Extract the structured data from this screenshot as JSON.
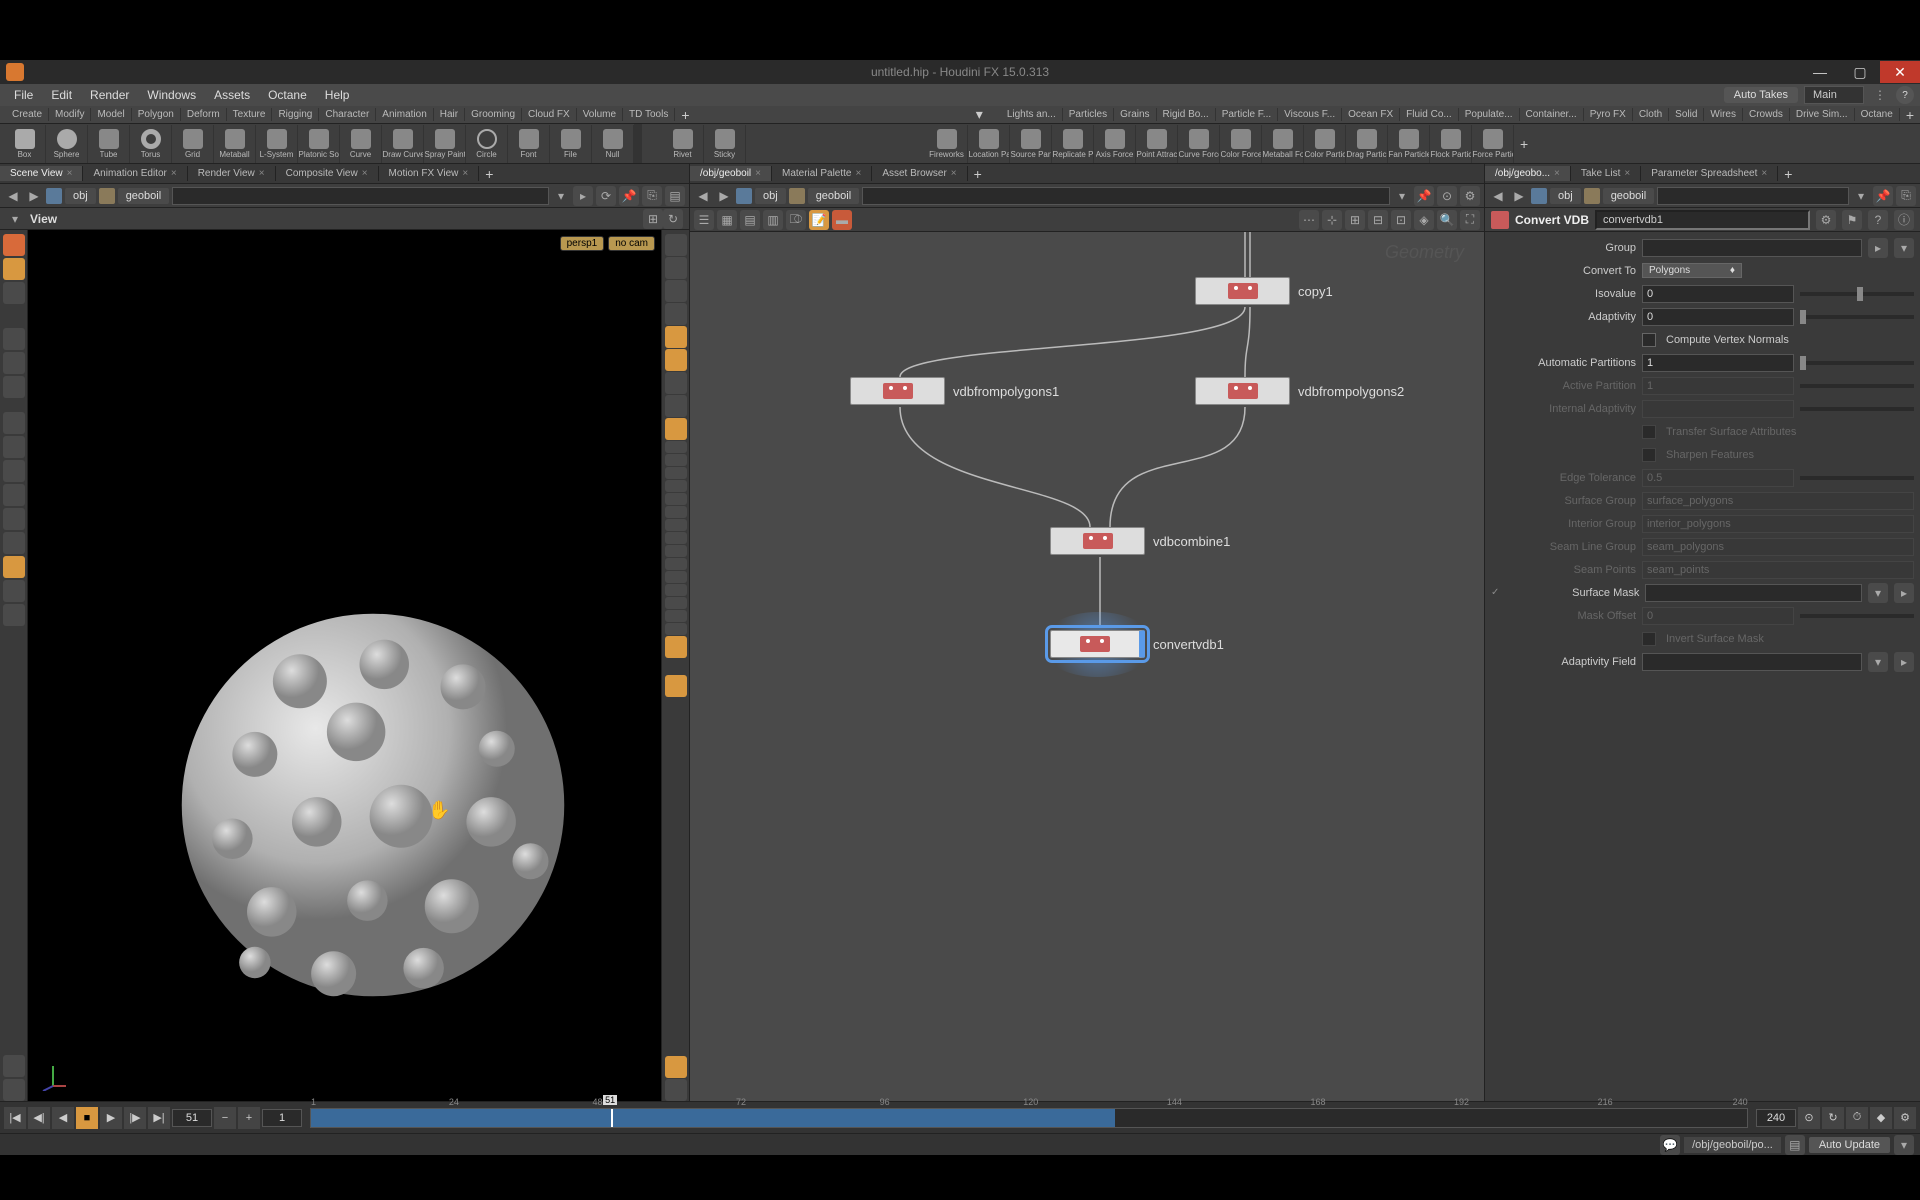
{
  "window": {
    "title": "untitled.hip - Houdini FX 15.0.313"
  },
  "menu": {
    "items": [
      "File",
      "Edit",
      "Render",
      "Windows",
      "Assets",
      "Octane",
      "Help"
    ],
    "auto_takes": "Auto Takes",
    "take": "Main"
  },
  "shelf_left": [
    "Create",
    "Modify",
    "Model",
    "Polygon",
    "Deform",
    "Texture",
    "Rigging",
    "Character",
    "Animation",
    "Hair",
    "Grooming",
    "Cloud FX",
    "Volume",
    "TD Tools"
  ],
  "shelf_right": [
    "Lights an...",
    "Particles",
    "Grains",
    "Rigid Bo...",
    "Particle F...",
    "Viscous F...",
    "Ocean FX",
    "Fluid Co...",
    "Populate...",
    "Container...",
    "Pyro FX",
    "Cloth",
    "Solid",
    "Wires",
    "Crowds",
    "Drive Sim...",
    "Octane"
  ],
  "tools_left": [
    "Box",
    "Sphere",
    "Tube",
    "Torus",
    "Grid",
    "Metaball",
    "L-System",
    "Platonic Sol...",
    "Curve",
    "Draw Curve",
    "Spray Paint",
    "Circle",
    "Font",
    "File",
    "Null"
  ],
  "tools_mid": [
    "Rivet",
    "Sticky"
  ],
  "tools_right": [
    "Fireworks",
    "Location Pa...",
    "Source Parti...",
    "Replicate P...",
    "Axis Force",
    "Point Attrac...",
    "Curve Force",
    "Color Force",
    "Metaball Fo...",
    "Color Particl...",
    "Drag Particles",
    "Fan Particles",
    "Flock Particl...",
    "Force Partic..."
  ],
  "left_tabs": [
    "Scene View",
    "Animation Editor",
    "Render View",
    "Composite View",
    "Motion FX View"
  ],
  "path": {
    "level1": "obj",
    "level2": "geoboil"
  },
  "view_label": "View",
  "vp_badges": {
    "persp": "persp1",
    "cam": "no cam"
  },
  "mid_tabs_path": "/obj/geoboil",
  "mid_tabs": [
    "Material Palette",
    "Asset Browser"
  ],
  "mid_path": {
    "level1": "obj",
    "level2": "geoboil"
  },
  "node_watermark": "Geometry",
  "nodes": {
    "copy1": "copy1",
    "vdbfrompolygons1": "vdbfrompolygons1",
    "vdbfrompolygons2": "vdbfrompolygons2",
    "vdbcombine1": "vdbcombine1",
    "convertvdb1": "convertvdb1"
  },
  "right_tabs_path": "/obj/geobo...",
  "right_tabs": [
    "Take List",
    "Parameter Spreadsheet"
  ],
  "right_path": {
    "level1": "obj",
    "level2": "geoboil"
  },
  "param": {
    "title": "Convert VDB",
    "name": "convertvdb1",
    "group_label": "Group",
    "group_value": "",
    "convert_to_label": "Convert To",
    "convert_to_value": "Polygons",
    "isovalue_label": "Isovalue",
    "isovalue_value": "0",
    "adaptivity_label": "Adaptivity",
    "adaptivity_value": "0",
    "compute_normals": "Compute Vertex Normals",
    "auto_partitions_label": "Automatic Partitions",
    "auto_partitions_value": "1",
    "active_partition_label": "Active Partition",
    "active_partition_value": "1",
    "internal_adaptivity_label": "Internal Adaptivity",
    "internal_adaptivity_value": "",
    "transfer_attrs": "Transfer Surface Attributes",
    "sharpen_features": "Sharpen Features",
    "edge_tolerance_label": "Edge Tolerance",
    "edge_tolerance_value": "0.5",
    "surface_group_label": "Surface Group",
    "surface_group_value": "surface_polygons",
    "interior_group_label": "Interior Group",
    "interior_group_value": "interior_polygons",
    "seam_group_label": "Seam Line Group",
    "seam_group_value": "seam_polygons",
    "seam_points_label": "Seam Points",
    "seam_points_value": "seam_points",
    "surface_mask_label": "Surface Mask",
    "mask_offset_label": "Mask Offset",
    "mask_offset_value": "0",
    "invert_mask": "Invert Surface Mask",
    "adaptivity_field_label": "Adaptivity Field"
  },
  "timeline": {
    "current": "51",
    "start": "1",
    "end": "240",
    "ticks": [
      "1",
      "24",
      "48",
      "72",
      "96",
      "120",
      "144",
      "168",
      "192",
      "216",
      "240"
    ]
  },
  "status": {
    "path": "/obj/geoboil/po...",
    "update": "Auto Update"
  }
}
